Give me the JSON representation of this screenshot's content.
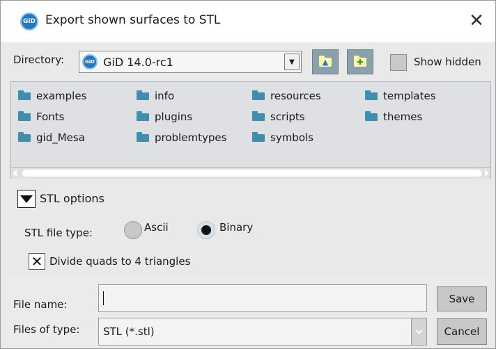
{
  "window": {
    "title": "Export shown surfaces to STL",
    "app_icon_text": "GiD"
  },
  "directory": {
    "label": "Directory:",
    "value": "GiD 14.0-rc1",
    "icon_text": "GiD",
    "up_button_icon": "folder-up-icon",
    "new_folder_button_icon": "new-folder-icon",
    "show_hidden_label": "Show hidden",
    "show_hidden_checked": false
  },
  "files": {
    "items": [
      {
        "name": "examples"
      },
      {
        "name": "Fonts"
      },
      {
        "name": "gid_Mesa"
      },
      {
        "name": "info"
      },
      {
        "name": "plugins"
      },
      {
        "name": "problemtypes"
      },
      {
        "name": "resources"
      },
      {
        "name": "scripts"
      },
      {
        "name": "symbols"
      },
      {
        "name": "templates"
      },
      {
        "name": "themes"
      }
    ]
  },
  "stl_options": {
    "label": "STL options",
    "expanded": true,
    "file_type_label": "STL file type:",
    "ascii_label": "Ascii",
    "binary_label": "Binary",
    "selected": "Binary",
    "divide_label": "Divide quads to 4 triangles",
    "divide_checked": true
  },
  "bottom": {
    "file_name_label": "File name:",
    "file_name_value": "",
    "save_label": "Save",
    "files_of_type_label": "Files of type:",
    "files_of_type_value": "STL (*.stl)",
    "cancel_label": "Cancel"
  },
  "colors": {
    "folder": "#3d8fb1",
    "app_icon": "#1f79c4",
    "tool_button": "#8aa1ab"
  }
}
